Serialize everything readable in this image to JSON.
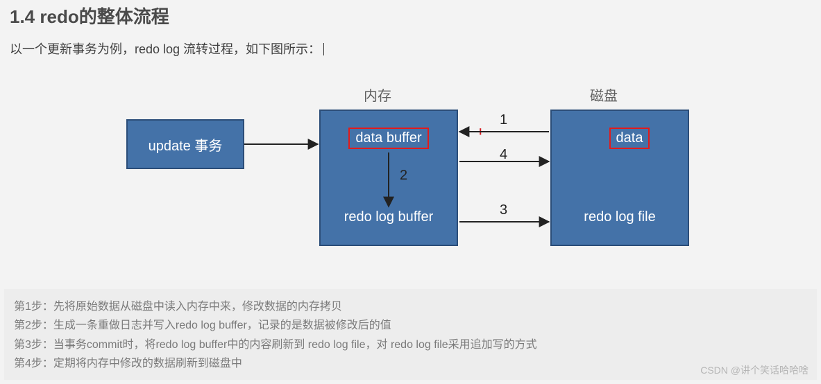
{
  "heading": "1.4 redo的整体流程",
  "intro_before": "以一个更新事务为例，redo log 流转过程，如下图所示：",
  "labels": {
    "memory": "内存",
    "disk": "磁盘"
  },
  "boxes": {
    "update": "update 事务",
    "data_buffer": "data buffer",
    "redo_log_buffer": "redo log buffer",
    "data": "data",
    "redo_log_file": "redo log file"
  },
  "arrow_numbers": {
    "n1": "1",
    "n2": "2",
    "n3": "3",
    "n4": "4"
  },
  "plus": "+",
  "steps": {
    "s1": "第1步：先将原始数据从磁盘中读入内存中来，修改数据的内存拷贝",
    "s2": "第2步：生成一条重做日志并写入redo log buffer，记录的是数据被修改后的值",
    "s3": "第3步：当事务commit时，将redo log buffer中的内容刷新到 redo log file，对 redo log file采用追加写的方式",
    "s4": "第4步：定期将内存中修改的数据刷新到磁盘中"
  },
  "watermark": "CSDN @讲个笑话哈哈啥"
}
